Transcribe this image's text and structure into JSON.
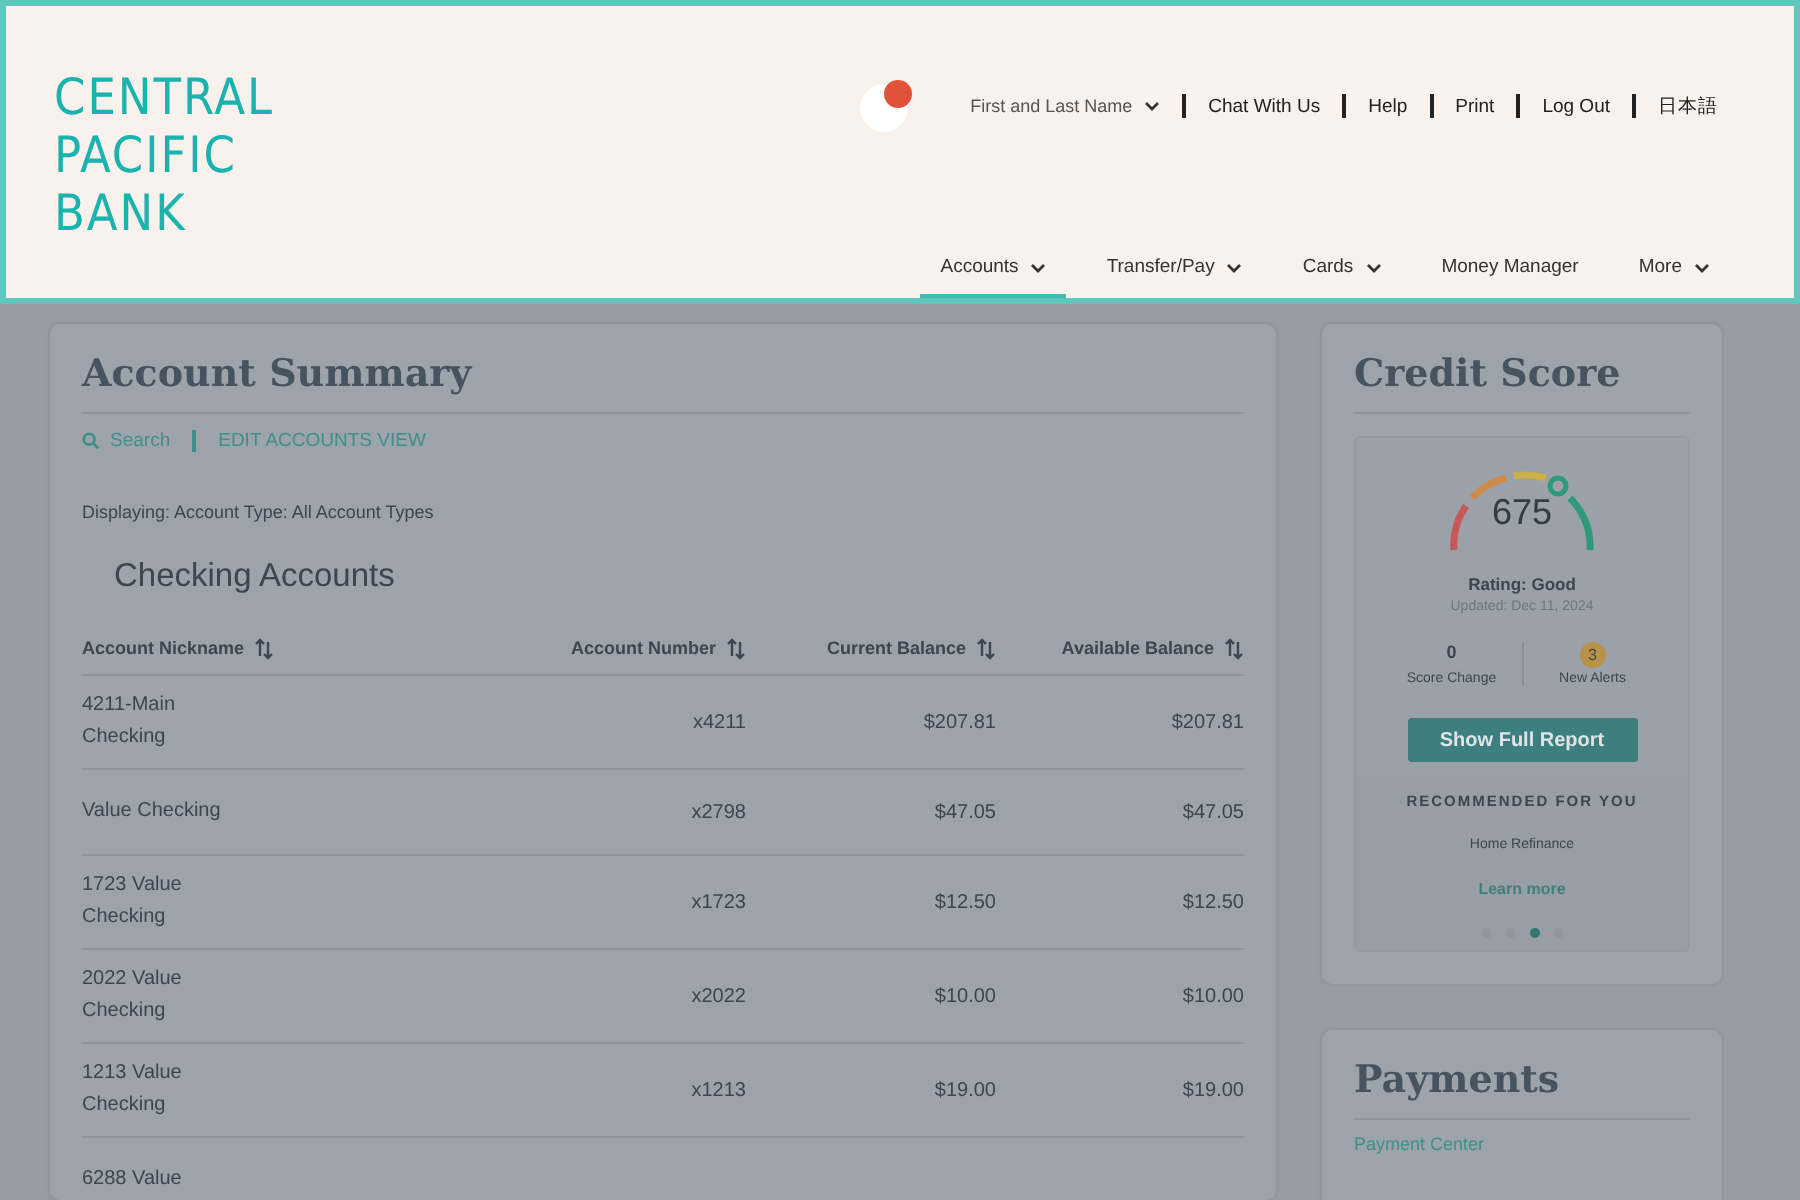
{
  "header": {
    "logo": [
      "CENTRAL",
      "PACIFIC",
      "BANK"
    ],
    "utility_links": [
      {
        "label": "First and Last Name",
        "has_menu": true
      },
      {
        "label": "Chat With Us",
        "has_menu": false
      },
      {
        "label": "Help",
        "has_menu": false
      },
      {
        "label": "Print",
        "has_menu": false
      },
      {
        "label": "Log Out",
        "has_menu": false
      },
      {
        "label": "日本語",
        "has_menu": false
      }
    ],
    "nav": [
      {
        "label": "Accounts",
        "has_menu": true,
        "selected": true
      },
      {
        "label": "Transfer/Pay",
        "has_menu": true,
        "selected": false
      },
      {
        "label": "Cards",
        "has_menu": true,
        "selected": false
      },
      {
        "label": "Money Manager",
        "has_menu": false,
        "selected": false
      },
      {
        "label": "More",
        "has_menu": true,
        "selected": false
      }
    ]
  },
  "account_summary": {
    "title": "Account Summary",
    "search": "Search",
    "edit_link": "EDIT ACCOUNTS VIEW",
    "filter": "Displaying: Account Type: All Account Types",
    "section": "Checking Accounts",
    "columns": [
      "Account Nickname",
      "Account Number",
      "Current Balance",
      "Available Balance"
    ],
    "rows": [
      {
        "nickname": "4211-Main Checking",
        "number": "x4211",
        "current": "$207.81",
        "available": "$207.81"
      },
      {
        "nickname": "Value Checking",
        "number": "x2798",
        "current": "$47.05",
        "available": "$47.05"
      },
      {
        "nickname": "1723 Value Checking",
        "number": "x1723",
        "current": "$12.50",
        "available": "$12.50"
      },
      {
        "nickname": "2022 Value Checking",
        "number": "x2022",
        "current": "$10.00",
        "available": "$10.00"
      },
      {
        "nickname": "1213 Value Checking",
        "number": "x1213",
        "current": "$19.00",
        "available": "$19.00"
      },
      {
        "nickname": "6288 Value"
      }
    ]
  },
  "credit_score": {
    "title": "Credit Score",
    "score": "675",
    "rating": "Rating: Good",
    "updated": "Updated: Dec 11, 2024",
    "stats": [
      {
        "value": "0",
        "label": "Score Change",
        "kind": "number"
      },
      {
        "value": "3",
        "label": "New Alerts",
        "kind": "badge"
      }
    ],
    "button": "Show Full Report",
    "recommended_heading": "RECOMMENDED FOR YOU",
    "recommendation": "Home Refinance",
    "learn_more": "Learn more",
    "dots": [
      {
        "selected": false
      },
      {
        "selected": false
      },
      {
        "selected": true
      },
      {
        "selected": false
      }
    ]
  },
  "payments": {
    "title": "Payments",
    "link": "Payment Center"
  }
}
